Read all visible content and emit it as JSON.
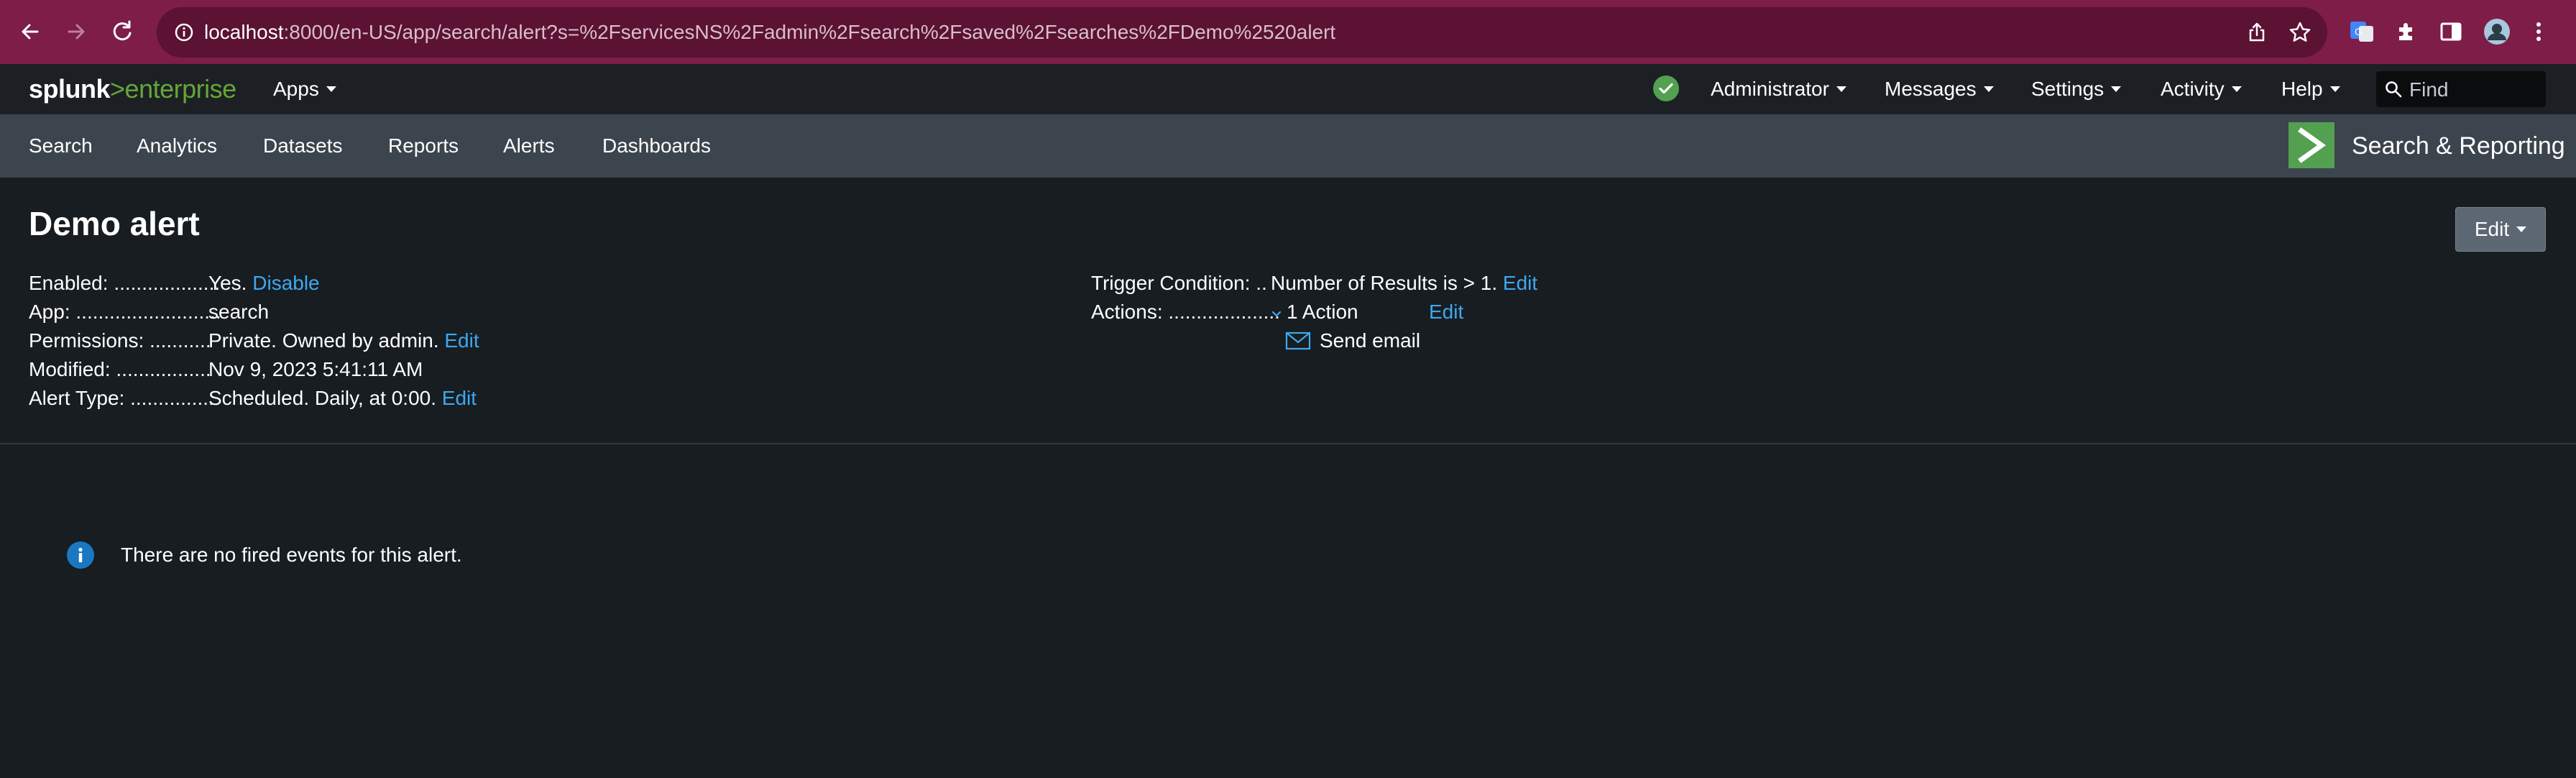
{
  "browser": {
    "url_host": "localhost",
    "url_rest": ":8000/en-US/app/search/alert?s=%2FservicesNS%2Fadmin%2Fsearch%2Fsaved%2Fsearches%2FDemo%2520alert"
  },
  "topbar": {
    "logo_main": "splunk",
    "logo_sep": ">",
    "logo_product": "enterprise",
    "apps_label": "Apps",
    "menus": {
      "administrator": "Administrator",
      "messages": "Messages",
      "settings": "Settings",
      "activity": "Activity",
      "help": "Help"
    },
    "find_placeholder": "Find",
    "status_color": "#53a051"
  },
  "appbar": {
    "nav": {
      "search": "Search",
      "analytics": "Analytics",
      "datasets": "Datasets",
      "reports": "Reports",
      "alerts": "Alerts",
      "dashboards": "Dashboards"
    },
    "app_title": "Search & Reporting"
  },
  "alert": {
    "title": "Demo alert",
    "edit_button": "Edit",
    "enabled_label": "Enabled: ...................",
    "enabled_value": "Yes.",
    "enabled_link": "Disable",
    "app_label": "App: ..........................",
    "app_value": "search",
    "permissions_label": "Permissions: ...........",
    "permissions_value": "Private. Owned by admin.",
    "permissions_link": "Edit",
    "modified_label": "Modified: .................",
    "modified_value": "Nov 9, 2023 5:41:11 AM",
    "alert_type_label": "Alert Type: ...............",
    "alert_type_value": "Scheduled. Daily, at 0:00.",
    "alert_type_link": "Edit",
    "trigger_label": "Trigger Condition: ..",
    "trigger_value": "Number of Results is > 1.",
    "trigger_link": "Edit",
    "actions_label": "Actions: ....................",
    "actions_value": "1 Action",
    "actions_link": "Edit",
    "action_item": "Send email"
  },
  "events": {
    "empty_message": "There are no fired events for this alert."
  },
  "colors": {
    "link": "#3ea8f0",
    "accent_green": "#53a051",
    "browser_chrome": "#7d1d48"
  }
}
